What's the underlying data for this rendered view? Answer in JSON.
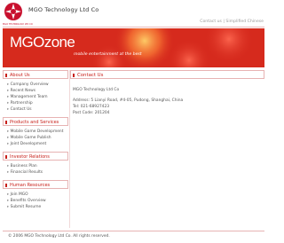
{
  "header": {
    "logo_alt": "MGO Technology logo",
    "logo_tag": "MGO TECHNOLOGY LTD CO",
    "company_name": "MGO Technology Ltd Co",
    "contact_link": "Contact us",
    "separator": "|",
    "lang_link": "Simplified Chinese"
  },
  "banner": {
    "logo_text": "MGOzone",
    "tagline": "mobile entertainment at the best"
  },
  "sidebar": {
    "about": {
      "title": "About Us",
      "items": [
        "Company Overview",
        "Recent News",
        "Management Team",
        "Partnership",
        "Contact Us"
      ]
    },
    "products": {
      "title": "Products and Services",
      "items": [
        "Mobile Game Development",
        "Mobile Game Publish",
        "Joint Development"
      ]
    },
    "investor": {
      "title": "Investor Relations",
      "items": [
        "Business Plan",
        "Financial Results"
      ]
    },
    "hr": {
      "title": "Human Resources",
      "items": [
        "Join MGO",
        "Benefits Overview",
        "Submit Resume"
      ]
    }
  },
  "content": {
    "title": "Contact Us",
    "company": "MGO Technology Ltd Co",
    "address": "Address: 5 Lianyi Road, #4-05, Pudong, Shanghai, China",
    "tel": "Tel: 021-68927423",
    "post": "Post Code: 201204"
  },
  "footer": {
    "copyright": "© 2006 MGO Technology Ltd Co. All rights reserved."
  },
  "colors": {
    "brand_red": "#c8201a",
    "banner_red": "#d62a1d",
    "section_border": "#e7b3b3"
  }
}
